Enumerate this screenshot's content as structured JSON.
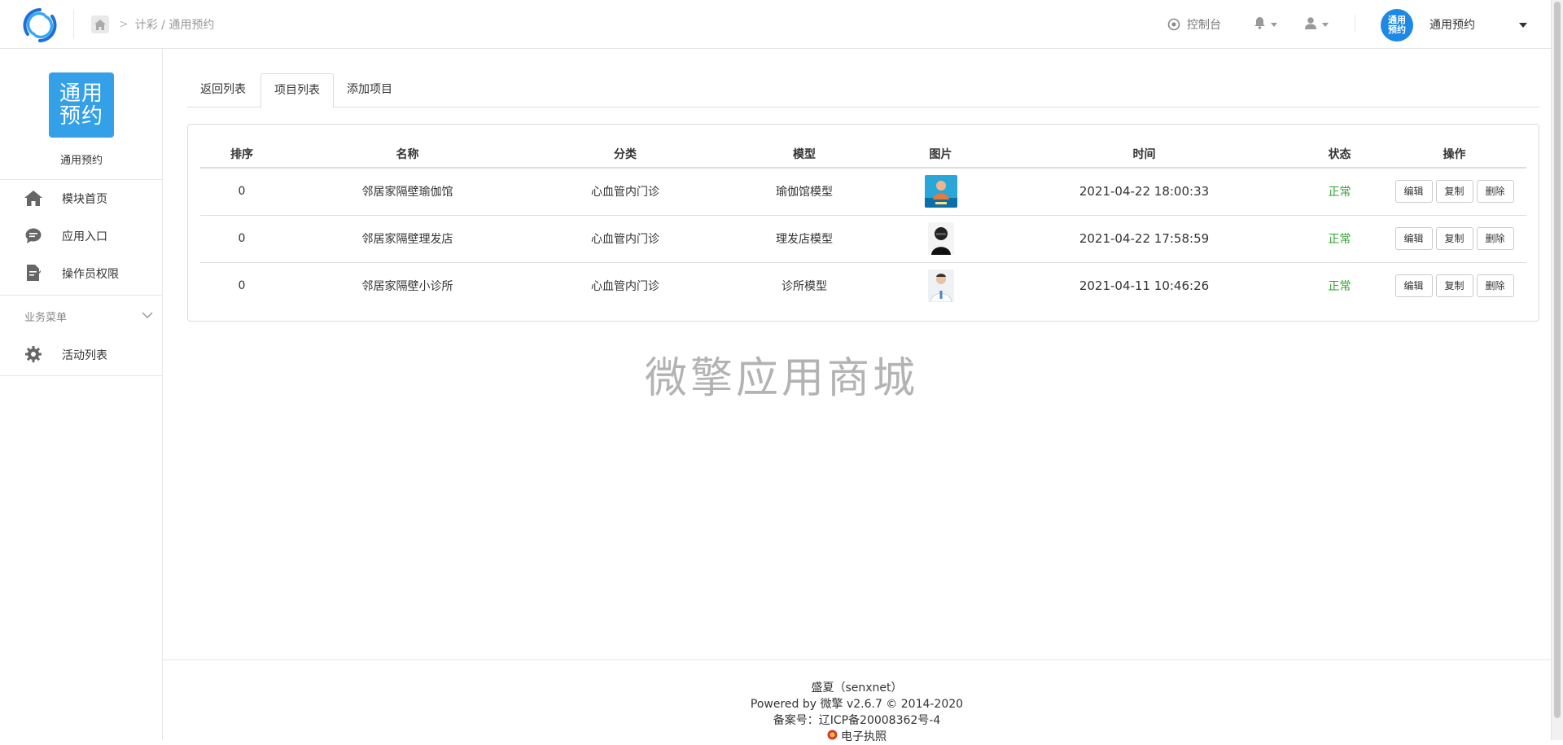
{
  "breadcrumb": {
    "path": "计彩 / 通用预约"
  },
  "header": {
    "console_label": "控制台",
    "account": {
      "avatar_text": "通用预约",
      "name": "通用预约"
    }
  },
  "sidebar": {
    "app_logo_text": "通用预约",
    "app_name": "通用预约",
    "items": [
      {
        "label": "模块首页",
        "icon": "home-icon"
      },
      {
        "label": "应用入口",
        "icon": "chat-icon"
      },
      {
        "label": "操作员权限",
        "icon": "document-icon"
      }
    ],
    "group": {
      "label": "业务菜单",
      "items": [
        {
          "label": "活动列表",
          "icon": "gear-icon"
        }
      ]
    }
  },
  "tabs": [
    {
      "label": "返回列表",
      "active": false
    },
    {
      "label": "项目列表",
      "active": true
    },
    {
      "label": "添加项目",
      "active": false
    }
  ],
  "table": {
    "headers": [
      "排序",
      "名称",
      "分类",
      "模型",
      "图片",
      "时间",
      "状态",
      "操作"
    ],
    "rows": [
      {
        "order": "0",
        "name": "邻居家隔壁瑜伽馆",
        "category": "心血管内门诊",
        "model": "瑜伽馆模型",
        "time": "2021-04-22 18:00:33",
        "status": "正常"
      },
      {
        "order": "0",
        "name": "邻居家隔壁理发店",
        "category": "心血管内门诊",
        "model": "理发店模型",
        "time": "2021-04-22 17:58:59",
        "status": "正常"
      },
      {
        "order": "0",
        "name": "邻居家隔壁小诊所",
        "category": "心血管内门诊",
        "model": "诊所模型",
        "time": "2021-04-11 10:46:26",
        "status": "正常"
      }
    ],
    "actions": {
      "edit": "编辑",
      "copy": "复制",
      "delete": "删除"
    }
  },
  "watermark": "微擎应用商城",
  "footer": {
    "line1": "盛夏（senxnet）",
    "line2": "Powered by 微擎 v2.6.7 © 2014-2020",
    "line3": "备案号：辽ICP备20008362号-4",
    "line4": "电子执照"
  },
  "colors": {
    "primary": "#34a0e8",
    "status_ok": "#2ea12e",
    "avatar": "#1e88e5"
  }
}
